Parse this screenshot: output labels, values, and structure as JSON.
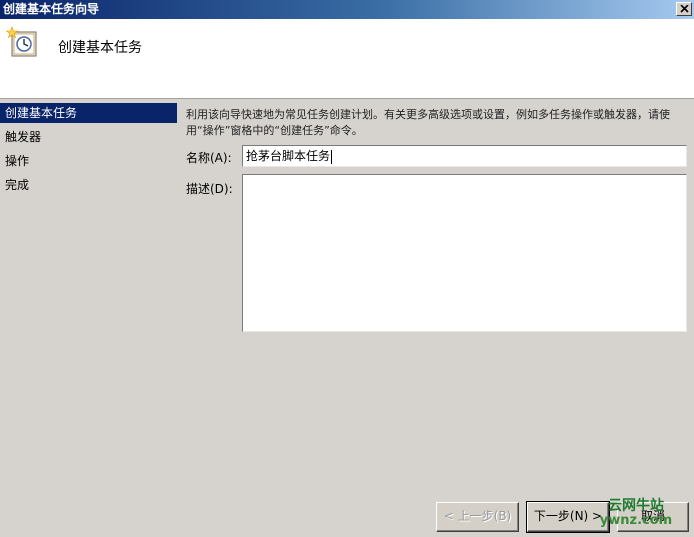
{
  "window": {
    "title": "创建基本任务向导"
  },
  "header": {
    "title": "创建基本任务",
    "icon": "scheduled-task-clock-icon"
  },
  "nav": {
    "items": [
      {
        "label": "创建基本任务",
        "active": true
      },
      {
        "label": "触发器",
        "active": false
      },
      {
        "label": "操作",
        "active": false
      },
      {
        "label": "完成",
        "active": false
      }
    ]
  },
  "main": {
    "description": "利用该向导快速地为常见任务创建计划。有关更多高级选项或设置，例如多任务操作或触发器，请使用“操作”窗格中的“创建任务”命令。",
    "name_label": "名称(A):",
    "name_value": "抢茅台脚本任务",
    "desc_label": "描述(D):",
    "desc_value": ""
  },
  "buttons": {
    "prev": "< 上一步(B)",
    "next": "下一步(N) >",
    "cancel": "取消"
  },
  "watermark": {
    "cn": "云网牛站",
    "en": "ywnz.com"
  },
  "colors": {
    "accent_selected": "#0a246a",
    "dialog_bg": "#d6d3ce",
    "watermark_green": "#1e7a2e"
  }
}
